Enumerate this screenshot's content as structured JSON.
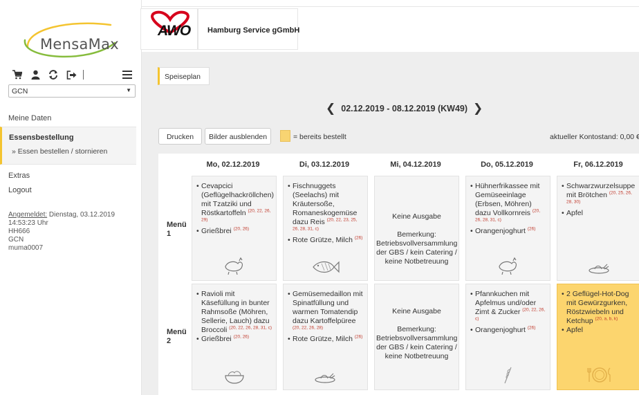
{
  "sidebar": {
    "logo_text": "MensaMax",
    "select_value": "GCN",
    "link_meine_daten": "Meine Daten",
    "active_section": "Essensbestellung",
    "active_sub": "» Essen bestellen / stornieren",
    "link_extras": "Extras",
    "link_logout": "Logout",
    "info_label": "Angemeldet:",
    "info_date": " Dienstag, 03.12.2019",
    "info_time": "14:53:23 Uhr",
    "info_user": "HH666",
    "info_group": "GCN",
    "info_login": "muma0007"
  },
  "header": {
    "awo_logo_text": "AWO",
    "org_name": "Hamburg Service gGmbH"
  },
  "main": {
    "tab_label": "Speiseplan",
    "week_label": "02.12.2019 - 08.12.2019 (KW49)",
    "btn_print": "Drucken",
    "btn_hide_images": "Bilder ausblenden",
    "legend_text": "= bereits bestellt",
    "balance_text": "aktueller Kontostand: 0,00 €",
    "accent_color": "#f4c430",
    "booked_color": "#fcd56e"
  },
  "plan": {
    "days": [
      "Mo, 02.12.2019",
      "Di, 03.12.2019",
      "Mi, 04.12.2019",
      "Do, 05.12.2019",
      "Fr, 06.12.2019"
    ],
    "menu1_label": "Menü",
    "menu1_num": "1",
    "menu2_label": "Menü",
    "menu2_num": "2",
    "no_service": "Keine Ausgabe",
    "remark": "Bemerkung: Betriebsvollversammlung der GBS / kein Catering / keine Notbetreuung",
    "m1": {
      "mo_1": "Cevapcici (Geflügelhackröllchen) mit Tzatziki und Röstkartoffeln",
      "mo_1_sup": "(20, 22, 26, 29)",
      "mo_2": "Grießbrei",
      "mo_2_sup": "(20, 26)",
      "mo_icon": "chicken-icon",
      "di_1": "Fischnuggets (Seelachs) mit Kräutersoße, Romaneskogemüse dazu Reis",
      "di_1_sup": "(20, 22, 23, 25, 26, 28, 31, c)",
      "di_2": "Rote Grütze, Milch",
      "di_2_sup": "(26)",
      "di_icon": "fish-icon",
      "do_1": "Hühnerfrikassee mit Gemüseeinlage (Erbsen, Möhren) dazu Vollkornreis",
      "do_1_sup": "(20, 26, 28, 31, c)",
      "do_2": "Orangenjoghurt",
      "do_2_sup": "(26)",
      "do_icon": "chicken-icon",
      "fr_1": "Schwarzwurzelsuppe mit Brötchen",
      "fr_1_sup": "(20, 25, 26, 28, 30)",
      "fr_2": "Apfel",
      "fr_icon": "vegetable-icon"
    },
    "m2": {
      "mo_1": "Ravioli mit Käsefüllung in bunter Rahmsoße (Möhren, Sellerie, Lauch) dazu Broccoli",
      "mo_1_sup": "(20, 22, 26, 28, 31, c)",
      "mo_2": "Grießbrei",
      "mo_2_sup": "(20, 26)",
      "mo_icon": "bowl-icon",
      "di_1": "Gemüsemedaillon mit Spinatfüllung und warmen Tomatendip dazu Kartoffelpüree",
      "di_1_sup": "(20, 22, 26, 28)",
      "di_2": "Rote Grütze, Milch",
      "di_2_sup": "(26)",
      "di_icon": "vegetable-icon",
      "do_1": "Pfannkuchen mit Apfelmus und/oder Zimt & Zucker",
      "do_1_sup": "(20, 22, 26, c)",
      "do_2": "Orangenjoghurt",
      "do_2_sup": "(26)",
      "do_icon": "wheat-icon",
      "fr_1": "2 Geflügel-Hot-Dog mit Gewürzgurken, Röstzwiebeln und Ketchup",
      "fr_1_sup": "(20, a, b, k)",
      "fr_2": "Apfel",
      "fr_icon": "plate-icon"
    }
  }
}
